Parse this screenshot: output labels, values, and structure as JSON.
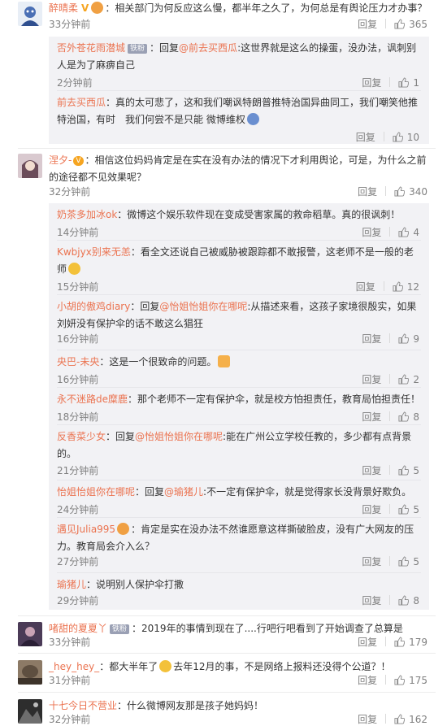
{
  "ui": {
    "reply_label": "回复"
  },
  "comments": [
    {
      "user": "醉晴柔",
      "text": "：相关部门为何反应这么慢，都半年之久了，为何总是有舆论压力才办事？",
      "time": "33分钟前",
      "likes": "365",
      "subs": [
        {
          "user": "否外苍花雨潜城",
          "badge": "铁粉",
          "pre": "：回复",
          "mention": "@前去买西瓜",
          "text": ":这世界就是这么的操蛋，没办法，讽刺别人是为了麻痹自己",
          "time": "2分钟前",
          "likes": "1"
        },
        {
          "user": "前去买西瓜",
          "text": "：真的太可悲了，这和我们嘲讽特朗普推特治国异曲同工，我们嘲笑他推特治国，有时　我们何尝不是只能 微博维权",
          "time": "2分钟前",
          "likes": "10"
        }
      ]
    },
    {
      "user": "涅夕-",
      "text": "：相信这位妈妈肯定是在实在没有办法的情况下才利用舆论，可是，为什么之前的途径都不见效果呢？",
      "time": "32分钟前",
      "likes": "340",
      "subs": [
        {
          "user": "奶茶多加冰ok",
          "text": "：微博这个娱乐软件现在变成受害家属的救命稻草。真的很讽刺！",
          "time": "14分钟前",
          "likes": "4"
        },
        {
          "user": "Kwbjyx别来无恙",
          "text": "：看全文还说自己被威胁被跟踪都不敢报警，这老师不是一般的老师",
          "time": "15分钟前",
          "likes": "12"
        },
        {
          "user": "小胡的傲鸡diary",
          "pre": "：回复",
          "mention": "@怡姐怡姐你在哪呢",
          "text": ":从描述来看，这孩子家境很殷实，如果刘妍没有保护伞的话不敢这么猖狂",
          "time": "16分钟前",
          "likes": "9"
        },
        {
          "user": "央巴-未央",
          "text": "：这是一个很致命的问题。",
          "time": "16分钟前",
          "likes": "2"
        },
        {
          "user": "永不迷路de糜鹿",
          "text": "：那个老师不一定有保护伞，就是校方怕担责任，教育局怕担责任！",
          "time": "18分钟前",
          "likes": "8"
        },
        {
          "user": "反香菜少女",
          "pre": "：回复",
          "mention": "@怡姐怡姐你在哪呢",
          "text": ":能在广州公立学校任教的，多少都有点背景的。",
          "time": "21分钟前",
          "likes": "5"
        },
        {
          "user": "怡姐怡姐你在哪呢",
          "pre": "：回复",
          "mention": "@瑜猪儿",
          "text": ":不一定有保护伞，就是觉得家长没背景好欺负。",
          "time": "24分钟前",
          "likes": "5"
        },
        {
          "user": "遇见Julia995",
          "text": "：肯定是实在没办法不然谁愿意这样撕破脸皮，没有广大网友的压力。教育局会介入么？",
          "time": "27分钟前",
          "likes": "5"
        },
        {
          "user": "瑜猪儿",
          "text": "：说明别人保护伞打撒",
          "time": "29分钟前",
          "likes": "8"
        }
      ]
    },
    {
      "user": "啫甜的夏夏丫",
      "badge": "铁粉",
      "text": "：2019年的事情到现在了....行吧行吧看到了开始调查了总算是",
      "time": "33分钟前",
      "likes": "179",
      "subs": []
    },
    {
      "user": "_hey_hey_",
      "text": "：都大半年了",
      "text2": "去年12月的事，不是网络上报料还没得个公道？！",
      "time": "31分钟前",
      "likes": "175",
      "subs": []
    },
    {
      "user": "十七今日不营业",
      "text": "：什么微博网友那是孩子她妈妈！",
      "time": "32分钟前",
      "likes": "162",
      "subs": []
    }
  ]
}
